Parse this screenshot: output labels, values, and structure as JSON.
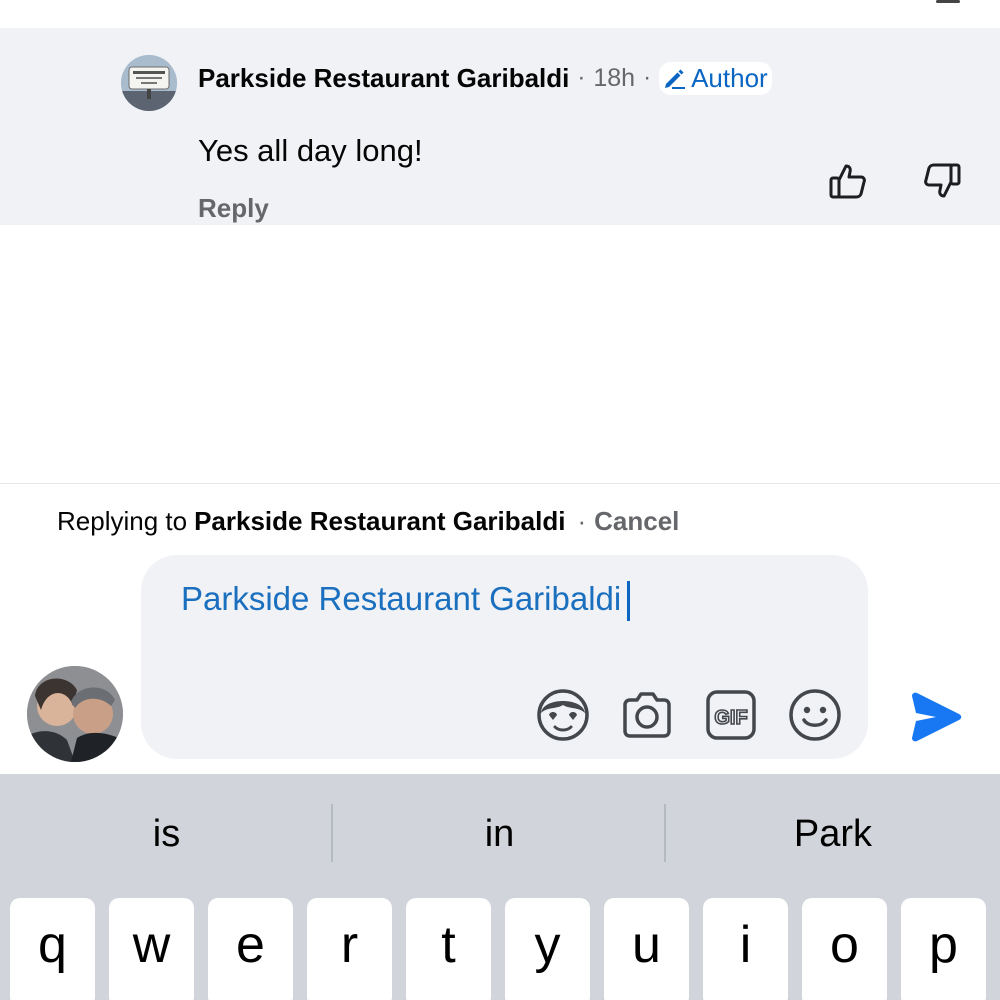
{
  "comment": {
    "author": "Parkside Restaurant Garibaldi",
    "separator": "·",
    "time": "18h",
    "badge_label": "Author",
    "text": "Yes all day long!",
    "reply_label": "Reply"
  },
  "composer": {
    "replying_prefix": "Replying to",
    "replying_name": "Parkside Restaurant Garibaldi",
    "separator": "·",
    "cancel_label": "Cancel",
    "input_value": "Parkside Restaurant Garibaldi",
    "tools": [
      "avatar-sticker-icon",
      "camera-icon",
      "gif-icon",
      "emoji-icon"
    ],
    "send_icon": "send-icon"
  },
  "keyboard": {
    "suggestions": [
      "is",
      "in",
      "Park"
    ],
    "row1": [
      "q",
      "w",
      "e",
      "r",
      "t",
      "y",
      "u",
      "i",
      "o",
      "p"
    ]
  },
  "colors": {
    "accent": "#0a66c2",
    "send": "#1877f2",
    "card_bg": "#f0f2f5",
    "keyboard_bg": "#d1d4db"
  }
}
